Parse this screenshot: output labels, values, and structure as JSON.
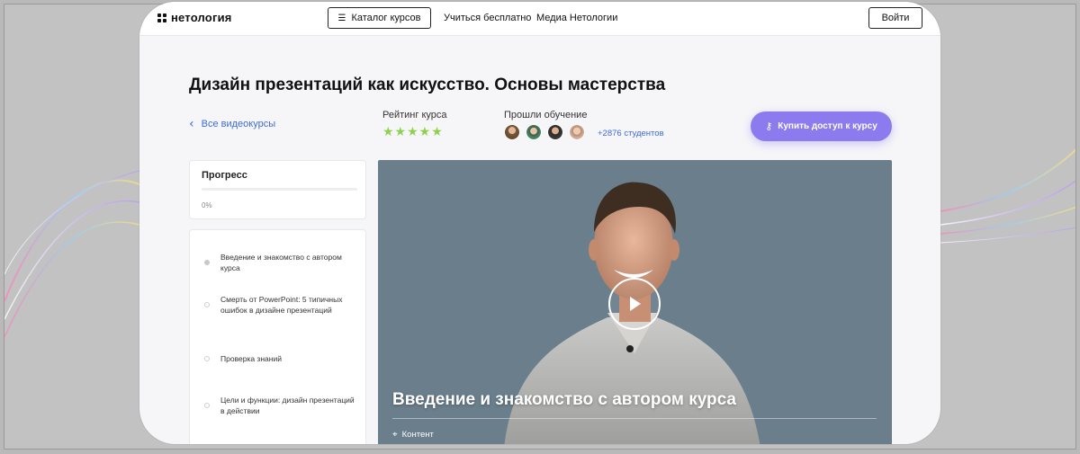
{
  "header": {
    "logo_text": "нетология",
    "catalog_label": "Каталог курсов",
    "nav": [
      "Учиться бесплатно",
      "Медиа Нетологии"
    ],
    "login_label": "Войти"
  },
  "course": {
    "title": "Дизайн презентаций как искусство. Основы мастерства",
    "back_label": "Все видеокурсы",
    "rating_label": "Рейтинг курса",
    "rating_stars": 5,
    "students_label": "Прошли обучение",
    "students_count": "+2876 студентов",
    "buy_label": "Купить доступ к курсу"
  },
  "progress": {
    "title": "Прогресс",
    "value_label": "0%",
    "fraction": 0
  },
  "lessons": [
    {
      "title": "Введение и знакомство с автором курса",
      "active": true
    },
    {
      "title": "Смерть от PowerPoint: 5 типичных ошибок в дизайне презентаций",
      "active": false
    },
    {
      "title": "Проверка знаний",
      "active": false
    },
    {
      "title": "Цели и функции: дизайн презентаций в действии",
      "active": false
    }
  ],
  "video": {
    "title": "Введение и знакомство с автором курса",
    "tag_label": "Контент"
  },
  "colors": {
    "accent": "#8b7bef",
    "link": "#3e6bd9",
    "stars": "#8fd14f",
    "video_bg": "#6b7e8c"
  },
  "icons": {
    "catalog": "catalog-search-icon",
    "back": "chevron-left-icon",
    "buy": "key-icon",
    "play": "play-icon",
    "tag": "tag-icon"
  }
}
